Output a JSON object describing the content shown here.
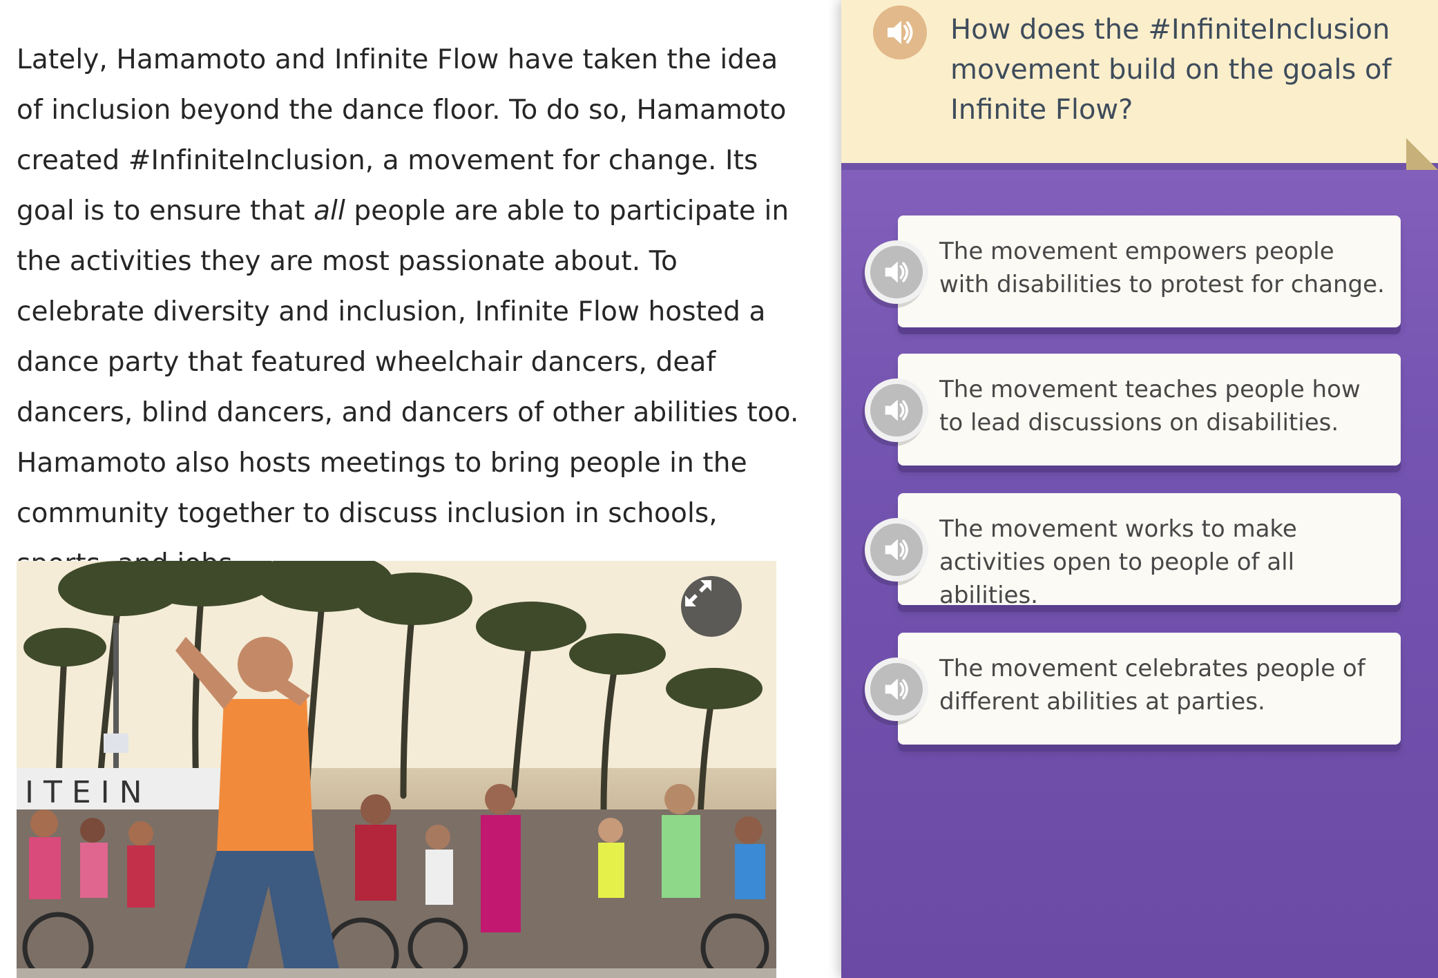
{
  "passage": {
    "text_before_em": "Lately, Hamamoto and Infinite Flow have taken the idea of inclusion beyond the dance floor. To do so, Hamamoto created #InfiniteInclusion, a movement for change. Its goal is to ensure that ",
    "em": "all",
    "text_after_em": " people are able to participate in the activities they are most passionate about. To celebrate diversity and inclusion, Infinite Flow hosted a dance party that featured wheelchair dancers, deaf dancers, blind dancers, and dancers of other abilities too. Hamamoto also hosts meetings to bring people in the community together to discuss inclusion in schools, sports, and jobs."
  },
  "photo": {
    "expand_icon": "expand-arrows-icon",
    "sign_letters": "I T E I N"
  },
  "question": {
    "audio_icon": "speaker-icon",
    "text": "How does the #InfiniteInclusion movement build on the goals of Infinite Flow?"
  },
  "answers": [
    {
      "text": "The movement empowers people with disabilities to protest for change.",
      "audio_icon": "speaker-icon"
    },
    {
      "text": "The movement teaches people how to lead discussions on disabilities.",
      "audio_icon": "speaker-icon"
    },
    {
      "text": "The movement works to make activities open to people of all abilities.",
      "audio_icon": "speaker-icon"
    },
    {
      "text": "The movement celebrates people of different abilities at parties.",
      "audio_icon": "speaker-icon"
    }
  ],
  "colors": {
    "question_bg": "#fbeecb",
    "panel_purple": "#7454b1",
    "question_audio": "#e2b98a",
    "answer_audio": "#bdbdbd"
  }
}
